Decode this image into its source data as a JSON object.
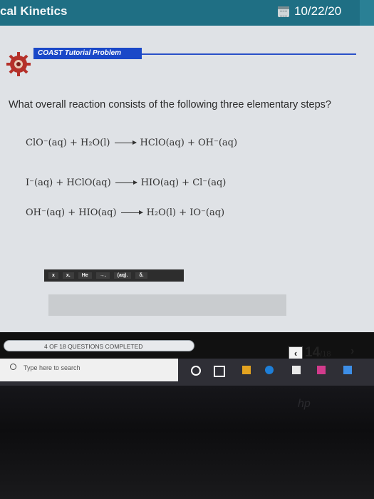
{
  "header": {
    "title": "cal Kinetics",
    "date": "10/22/20"
  },
  "banner": {
    "label": "COAST Tutorial Problem"
  },
  "question": "What overall reaction consists of the following three elementary steps?",
  "steps": [
    {
      "reactants": "ClO⁻(aq) + H₂O(l)",
      "products": "HClO(aq) + OH⁻(aq)"
    },
    {
      "reactants": "I⁻(aq) + HClO(aq)",
      "products": "HIO(aq) + Cl⁻(aq)"
    },
    {
      "reactants": "OH⁻(aq) + HIO(aq)",
      "products": "H₂O(l) + IO⁻(aq)"
    }
  ],
  "toolbar": {
    "buttons": [
      "x",
      "x.",
      "He",
      "→.",
      "(aq).",
      "δ."
    ]
  },
  "answer": {
    "value": ""
  },
  "progress": {
    "label": "4 OF 18 QUESTIONS COMPLETED",
    "completed": 4,
    "total": 18
  },
  "pager": {
    "current": "14",
    "total": "/18",
    "prev": "‹",
    "next": "›"
  },
  "taskbar": {
    "search_placeholder": "Type here to search"
  },
  "colors": {
    "header": "#1f6f84",
    "banner": "#1a48c8",
    "content": "#dfe2e6",
    "taskbar": "#2f2f36"
  }
}
